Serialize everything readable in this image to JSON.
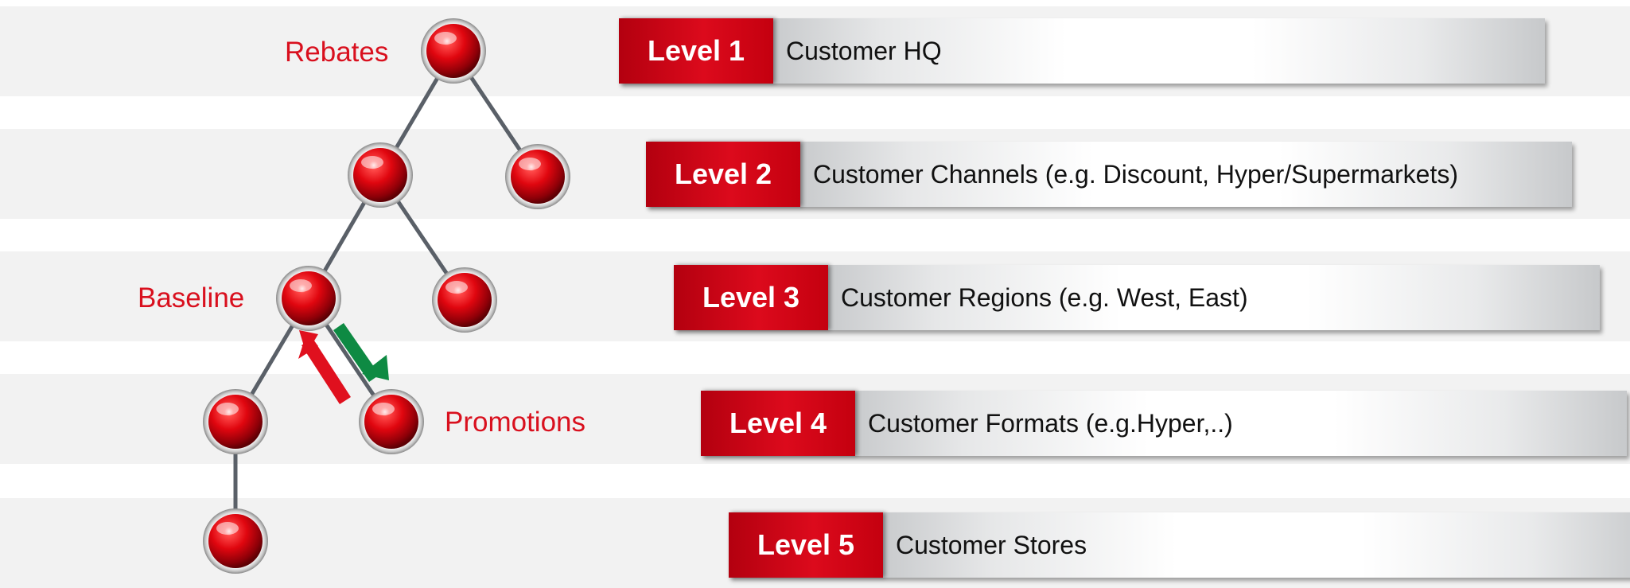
{
  "tree_labels": {
    "rebates": "Rebates",
    "baseline": "Baseline",
    "promotions": "Promotions"
  },
  "levels": [
    {
      "tag": "Level 1",
      "text": "Customer HQ"
    },
    {
      "tag": "Level 2",
      "text": "Customer Channels (e.g. Discount, Hyper/Supermarkets)"
    },
    {
      "tag": "Level 3",
      "text": "Customer Regions (e.g. West, East)"
    },
    {
      "tag": "Level 4",
      "text": "Customer Formats (e.g.Hyper,..)"
    },
    {
      "tag": "Level 5",
      "text": "Customer Stores"
    }
  ],
  "colors": {
    "accent_red": "#d9101e",
    "arrow_up": "#e0101e",
    "arrow_down": "#0e8a43",
    "band": "#f2f2f2"
  }
}
